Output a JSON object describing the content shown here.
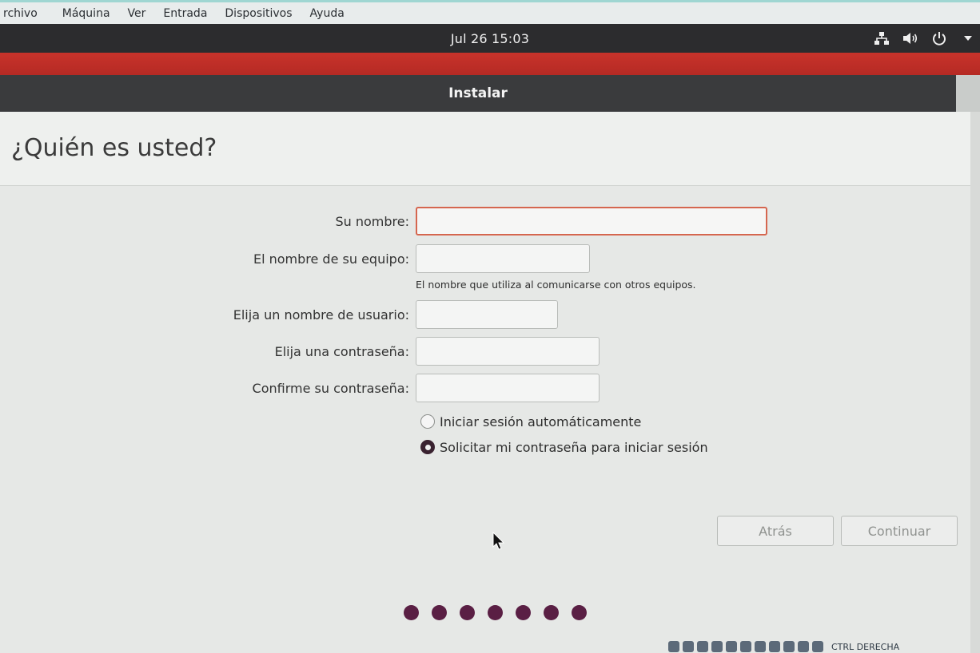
{
  "host_menu": {
    "items": [
      "rchivo",
      "Máquina",
      "Ver",
      "Entrada",
      "Dispositivos",
      "Ayuda"
    ]
  },
  "topbar": {
    "clock": "Jul 26  15:03",
    "tray_icons": [
      "network-icon",
      "volume-icon",
      "power-icon",
      "dropdown-arrow-icon"
    ]
  },
  "installer": {
    "window_title": "Instalar",
    "page_title": "¿Quién es usted?",
    "fields": {
      "name": {
        "label": "Su nombre:",
        "value": ""
      },
      "computer": {
        "label": "El nombre de su equipo:",
        "value": "",
        "hint": "El nombre que utiliza al comunicarse con otros equipos."
      },
      "username": {
        "label": "Elija un nombre de usuario:",
        "value": ""
      },
      "password": {
        "label": "Elija una contraseña:",
        "value": ""
      },
      "confirm": {
        "label": "Confirme su contraseña:",
        "value": ""
      }
    },
    "login_options": [
      {
        "label": "Iniciar sesión automáticamente",
        "checked": false
      },
      {
        "label": "Solicitar mi contraseña para iniciar sesión",
        "checked": true
      }
    ],
    "buttons": {
      "back": "Atrás",
      "continue": "Continuar"
    },
    "progress_steps": 7
  },
  "vbox_status": {
    "host_key": "CTRL DERECHA"
  },
  "colors": {
    "accent_red": "#c8332b",
    "progress_dot": "#5a1f44",
    "focus_border": "#d5664f"
  }
}
